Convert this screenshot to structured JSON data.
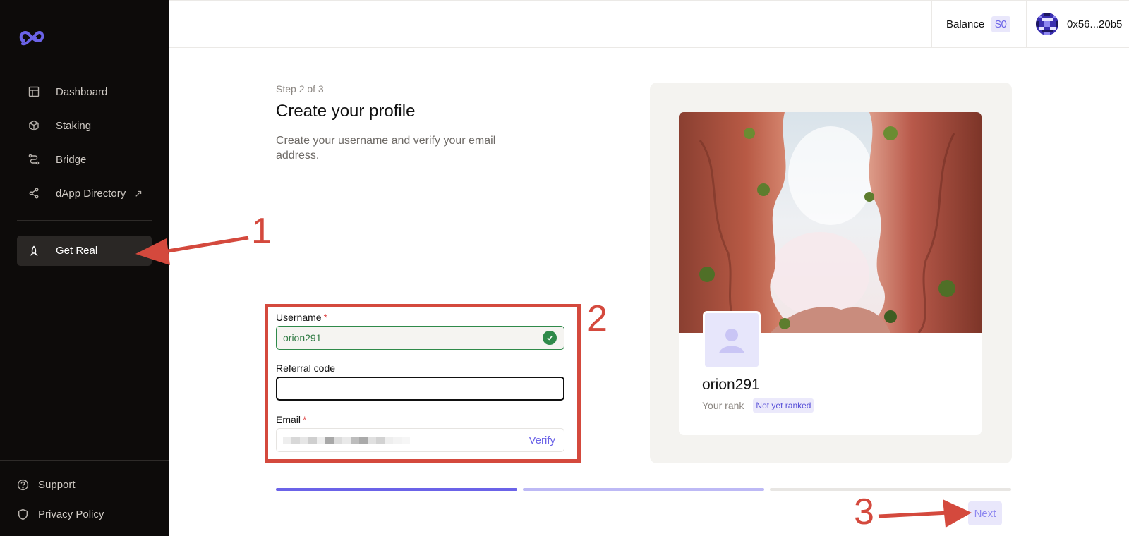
{
  "sidebar": {
    "items": [
      {
        "label": "Dashboard",
        "icon": "layout-icon"
      },
      {
        "label": "Staking",
        "icon": "cube-icon"
      },
      {
        "label": "Bridge",
        "icon": "route-icon"
      },
      {
        "label": "dApp Directory",
        "icon": "share-icon",
        "external": "↗"
      },
      {
        "label": "Get Real",
        "icon": "rocket-icon",
        "active": true
      }
    ],
    "footer": [
      {
        "label": "Support",
        "icon": "help-circle-icon"
      },
      {
        "label": "Privacy Policy",
        "icon": "shield-icon"
      }
    ]
  },
  "header": {
    "balance_label": "Balance",
    "balance_value": "$0",
    "address": "0x56...20b5"
  },
  "form": {
    "step": "Step 2 of 3",
    "title": "Create your profile",
    "subtitle": "Create your username and verify your email address.",
    "username_label": "Username",
    "username_value": "orion291",
    "referral_label": "Referral code",
    "referral_value": "",
    "email_label": "Email",
    "verify_label": "Verify",
    "required_mark": "*"
  },
  "preview": {
    "username": "orion291",
    "rank_label": "Your rank",
    "rank_value": "Not yet ranked"
  },
  "progress": {
    "current_step": 2,
    "total_steps": 3
  },
  "next_label": "Next",
  "annotations": [
    "1",
    "2",
    "3"
  ],
  "colors": {
    "accent": "#6b63e8",
    "success": "#2f8a4a",
    "annotation": "#d4493d",
    "sidebar_bg": "#0d0b0a"
  }
}
